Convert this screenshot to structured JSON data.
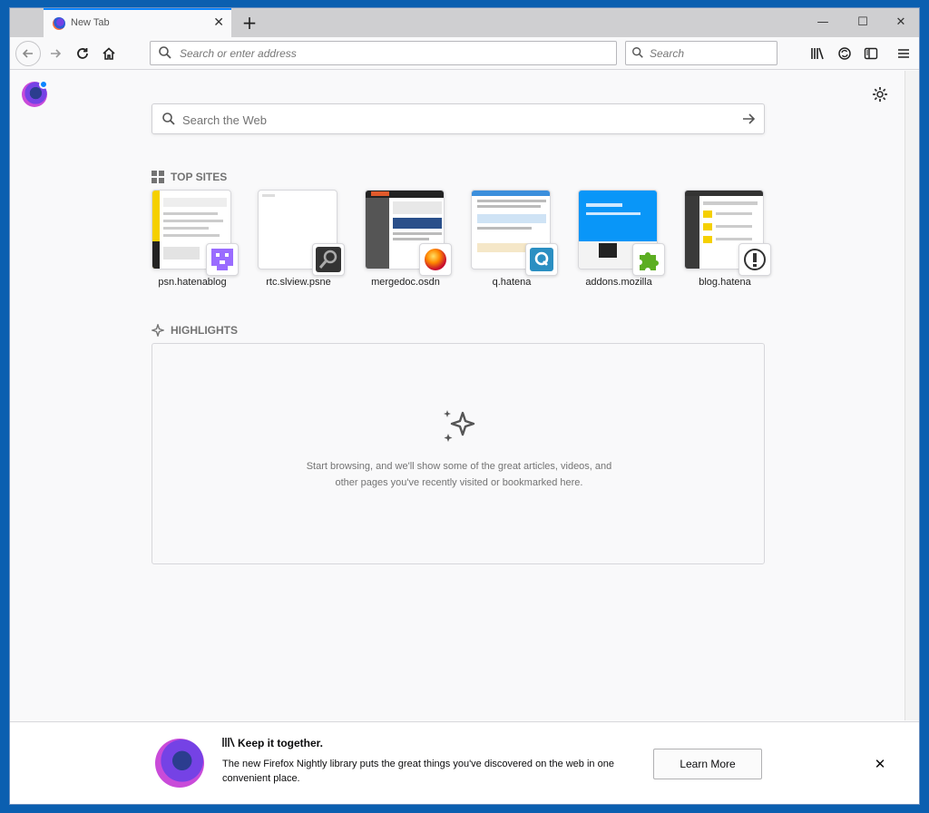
{
  "tab": {
    "title": "New Tab",
    "close": "✕"
  },
  "tabstrip": {
    "new_tab": "+"
  },
  "window_controls": {
    "minimize": "—",
    "maximize": "☐",
    "close": "✕"
  },
  "navbar": {
    "url_placeholder": "Search or enter address",
    "search_placeholder": "Search"
  },
  "newtab": {
    "web_search_placeholder": "Search the Web",
    "top_sites_title": "TOP SITES",
    "top_sites": [
      {
        "label": "psn.hatenablog"
      },
      {
        "label": "rtc.slview.psne"
      },
      {
        "label": "mergedoc.osdn"
      },
      {
        "label": "q.hatena"
      },
      {
        "label": "addons.mozilla"
      },
      {
        "label": "blog.hatena"
      }
    ],
    "highlights_title": "HIGHLIGHTS",
    "highlights_empty": "Start browsing, and we'll show some of the great articles, videos, and other pages you've recently visited or bookmarked here."
  },
  "snippet": {
    "title": "Keep it together.",
    "body": "The new Firefox Nightly library puts the great things you've discovered on the web in one convenient place.",
    "button": "Learn More",
    "close": "✕"
  },
  "colors": {
    "accent": "#0a84ff",
    "window_frame": "#0b5fb0"
  }
}
